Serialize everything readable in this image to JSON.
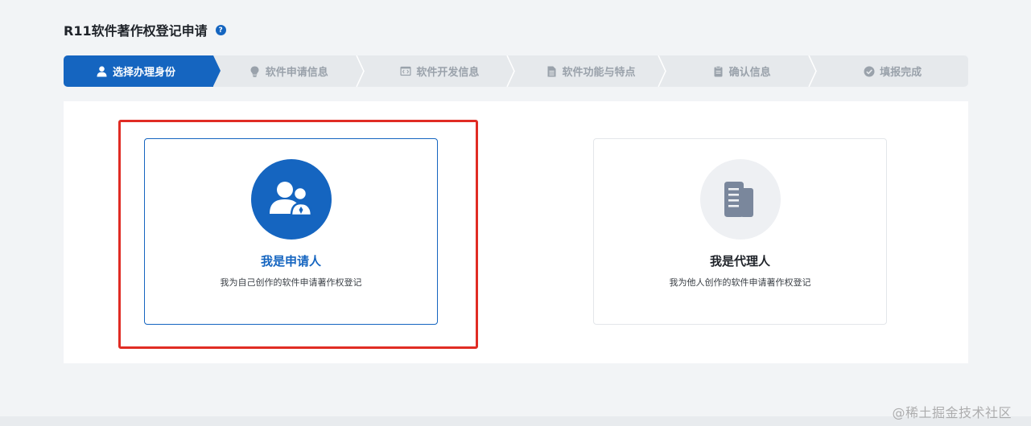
{
  "page": {
    "title": "R11软件著作权登记申请",
    "help_icon": "?"
  },
  "steps": [
    {
      "label": "选择办理身份",
      "icon": "user-icon",
      "active": true
    },
    {
      "label": "软件申请信息",
      "icon": "lightbulb-icon",
      "active": false
    },
    {
      "label": "软件开发信息",
      "icon": "code-window-icon",
      "active": false
    },
    {
      "label": "软件功能与特点",
      "icon": "document-icon",
      "active": false
    },
    {
      "label": "确认信息",
      "icon": "clipboard-icon",
      "active": false
    },
    {
      "label": "填报完成",
      "icon": "check-circle-icon",
      "active": false
    }
  ],
  "cards": {
    "applicant": {
      "title": "我是申请人",
      "desc": "我为自己创作的软件申请著作权登记",
      "icon": "users-icon",
      "selected": true
    },
    "agent": {
      "title": "我是代理人",
      "desc": "我为他人创作的软件申请著作权登记",
      "icon": "documents-icon",
      "selected": false
    }
  },
  "watermark": "@稀土掘金技术社区",
  "colors": {
    "primary": "#1565c0",
    "highlight": "#e02c24",
    "inactive_text": "#9aa2ab"
  }
}
